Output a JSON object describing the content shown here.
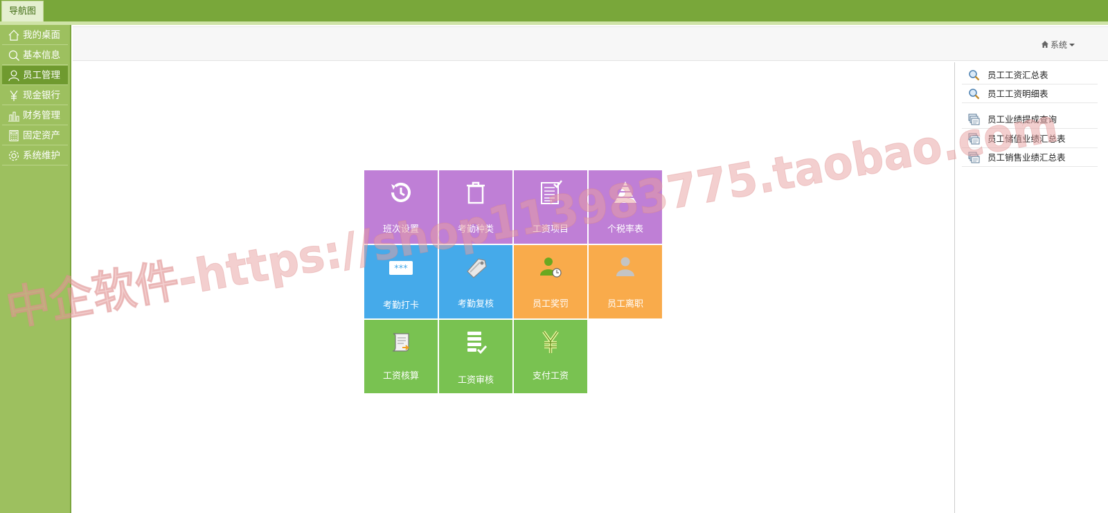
{
  "nav_tab": {
    "label": "导航图"
  },
  "sidebar": {
    "items": [
      {
        "label": "我的桌面",
        "icon": "home-icon"
      },
      {
        "label": "基本信息",
        "icon": "search-icon"
      },
      {
        "label": "员工管理",
        "icon": "user-icon"
      },
      {
        "label": "现金银行",
        "icon": "yen-icon"
      },
      {
        "label": "财务管理",
        "icon": "bar-chart-icon"
      },
      {
        "label": "固定资产",
        "icon": "calculator-icon"
      },
      {
        "label": "系统维护",
        "icon": "gear-icon"
      }
    ],
    "active_index": 2
  },
  "header": {
    "system_menu": "系统"
  },
  "tiles": [
    {
      "label": "班次设置",
      "icon": "clock-history-icon",
      "color": "#bf7fd6"
    },
    {
      "label": "考勤种类",
      "icon": "trash-icon",
      "color": "#bf7fd6"
    },
    {
      "label": "工资项目",
      "icon": "checklist-icon",
      "color": "#bf7fd6"
    },
    {
      "label": "个税率表",
      "icon": "pyramid-icon",
      "color": "#bf7fd6"
    },
    {
      "label": "考勤打卡",
      "icon": "password-card-icon",
      "color": "#45aaea"
    },
    {
      "label": "考勤复核",
      "icon": "tag-icon",
      "color": "#45aaea"
    },
    {
      "label": "员工奖罚",
      "icon": "user-clock-icon",
      "color": "#f9ab4b"
    },
    {
      "label": "员工离职",
      "icon": "user-gray-icon",
      "color": "#f9ab4b"
    },
    {
      "label": "工资核算",
      "icon": "scroll-icon",
      "color": "#79c251"
    },
    {
      "label": "工资审核",
      "icon": "list-check-icon",
      "color": "#79c251"
    },
    {
      "label": "支付工资",
      "icon": "yen-icon",
      "color": "#79c251"
    }
  ],
  "right_panel": {
    "items": [
      {
        "label": "员工工资汇总表",
        "icon": "magnifier-icon"
      },
      {
        "label": "员工工资明细表",
        "icon": "magnifier-icon"
      },
      {
        "label": "员工业绩提成查询",
        "icon": "stack-icon"
      },
      {
        "label": "员工储值业绩汇总表",
        "icon": "stack-icon"
      },
      {
        "label": "员工销售业绩汇总表",
        "icon": "stack-icon"
      }
    ]
  },
  "watermark": {
    "text": "中企软件-https://shop113983775.taobao.com",
    "color": "#e8a0a0"
  }
}
